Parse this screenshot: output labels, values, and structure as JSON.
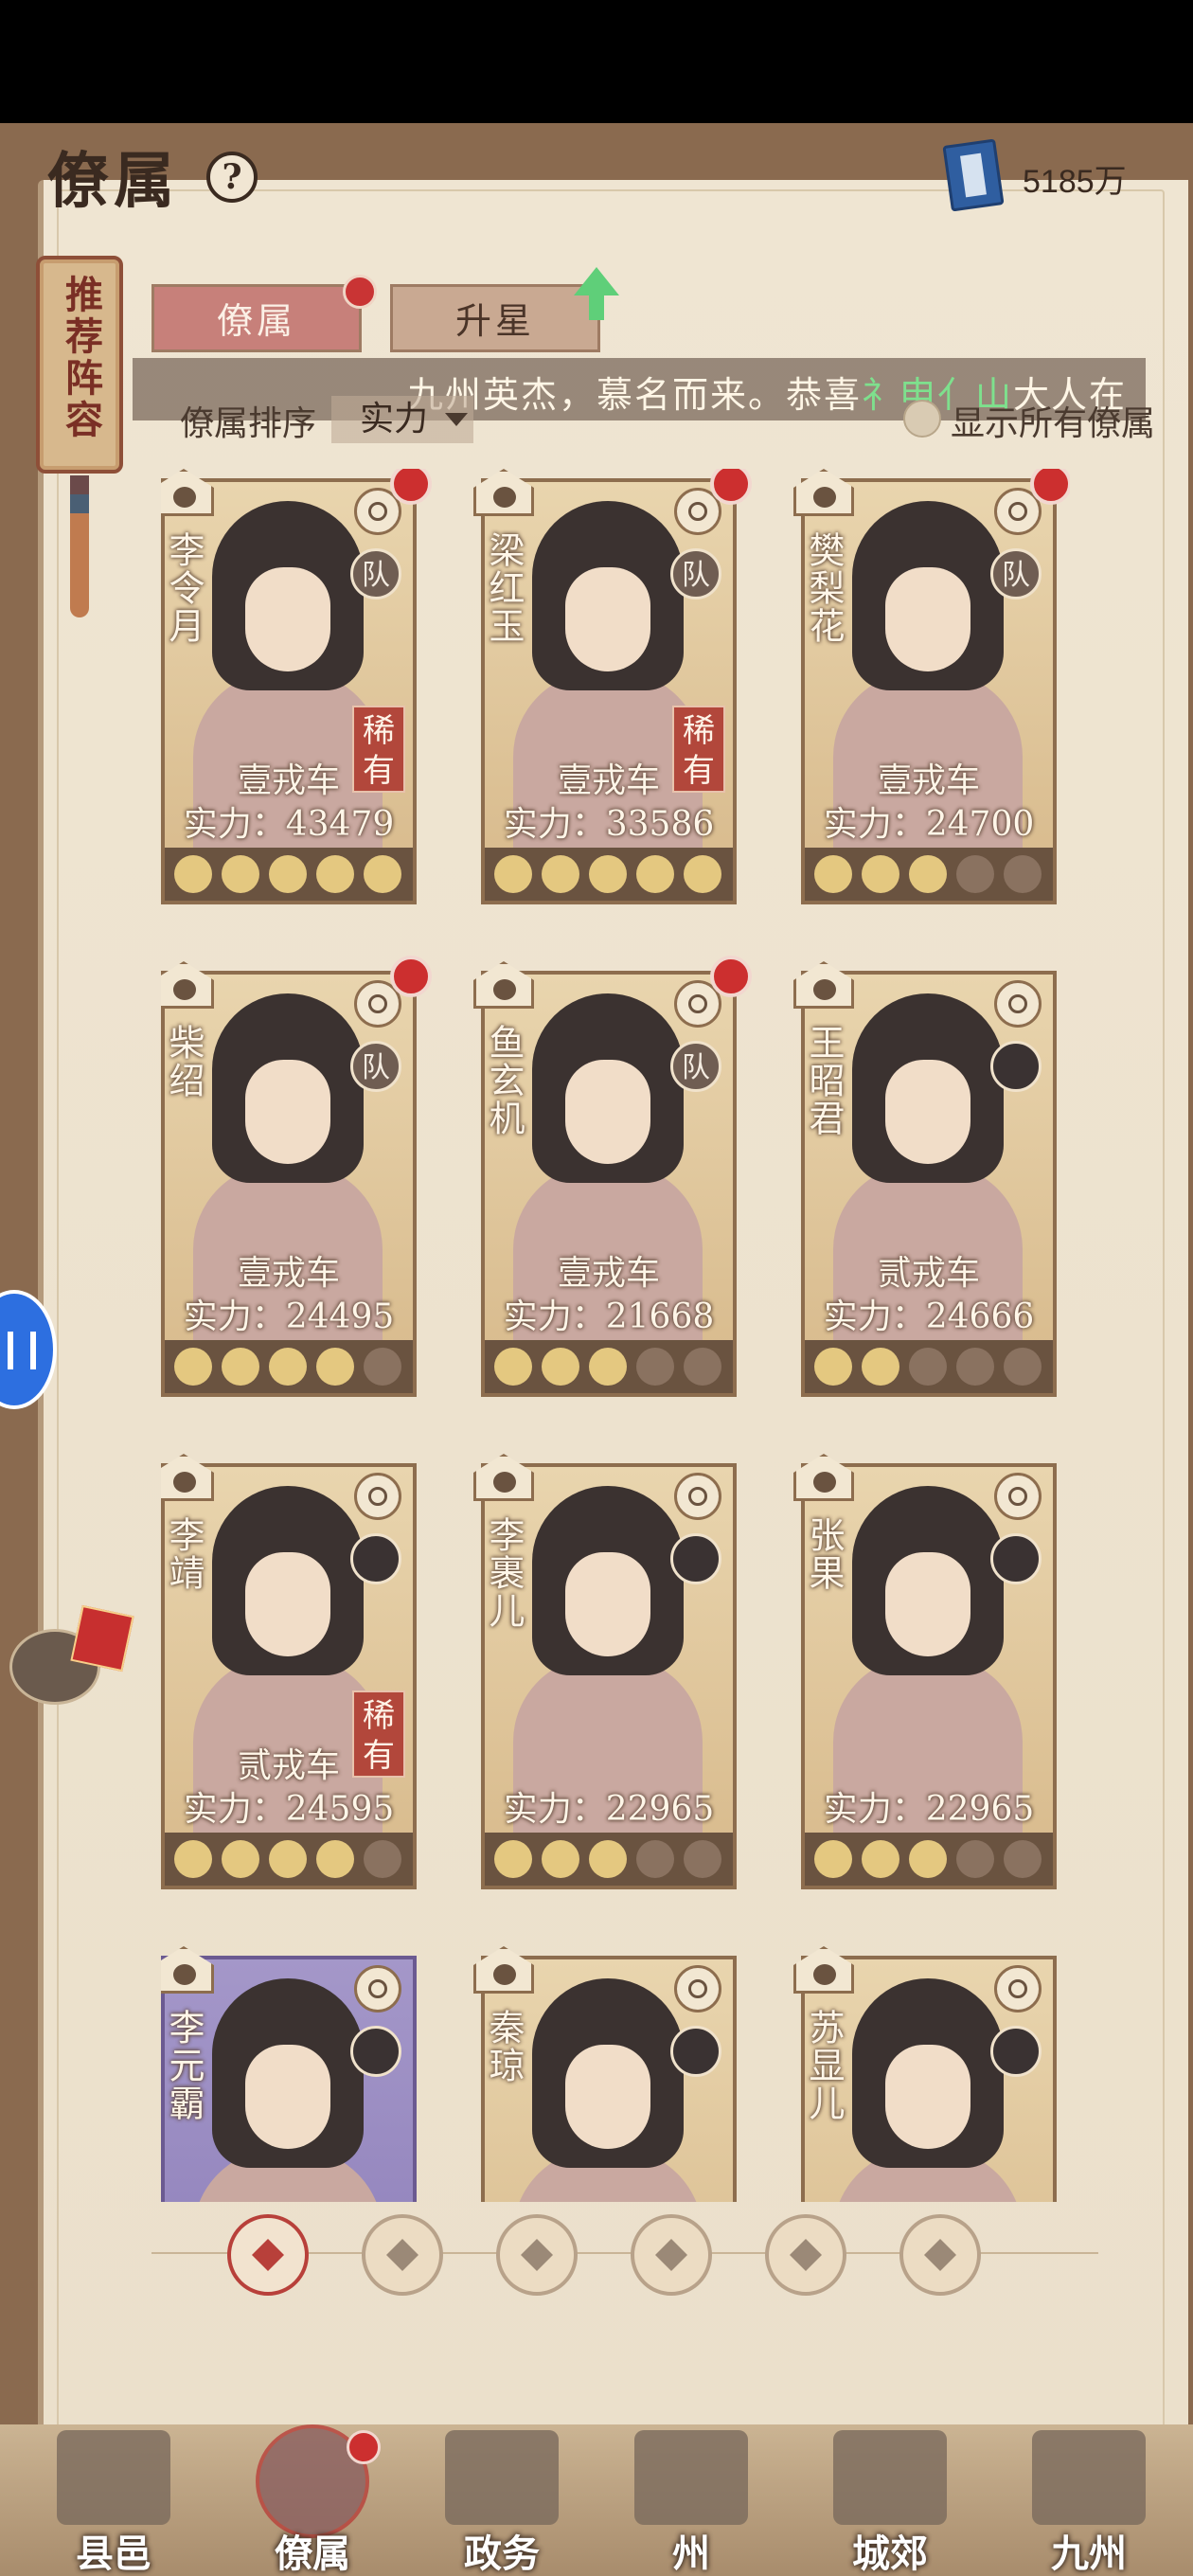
{
  "header": {
    "title": "僚属",
    "help_icon": "?",
    "currency_amount": "5185万"
  },
  "side_tag": {
    "text": "推荐阵容"
  },
  "tabs": [
    {
      "label": "僚属",
      "active": true,
      "has_badge": true
    },
    {
      "label": "升星",
      "active": false,
      "has_badge": false
    }
  ],
  "marquee": {
    "prefix": "九州英杰，慕名而来。恭喜",
    "highlight": "礻申亻山",
    "suffix": "大人在"
  },
  "sort": {
    "label": "僚属排序",
    "value": "实力",
    "show_all_label": "显示所有僚属"
  },
  "cards": [
    {
      "name": "李令月",
      "rank": "壹戎车",
      "power": "实力：43479",
      "rare": "稀有",
      "team": "队",
      "moons_filled": 5,
      "badge": true
    },
    {
      "name": "梁红玉",
      "rank": "壹戎车",
      "power": "实力：33586",
      "rare": "稀有",
      "team": "队",
      "moons_filled": 5,
      "badge": true
    },
    {
      "name": "樊梨花",
      "rank": "壹戎车",
      "power": "实力：24700",
      "rare": "",
      "team": "队",
      "moons_filled": 3,
      "badge": true
    },
    {
      "name": "柴绍",
      "rank": "壹戎车",
      "power": "实力：24495",
      "rare": "",
      "team": "队",
      "moons_filled": 4,
      "badge": true
    },
    {
      "name": "鱼玄机",
      "rank": "壹戎车",
      "power": "实力：21668",
      "rare": "",
      "team": "队",
      "moons_filled": 3,
      "badge": true
    },
    {
      "name": "王昭君",
      "rank": "贰戎车",
      "power": "实力：24666",
      "rare": "",
      "team": "",
      "moons_filled": 2,
      "badge": false
    },
    {
      "name": "李靖",
      "rank": "贰戎车",
      "power": "实力：24595",
      "rare": "稀有",
      "team": "",
      "moons_filled": 4,
      "badge": false
    },
    {
      "name": "李裹儿",
      "rank": "",
      "power": "实力：22965",
      "rare": "",
      "team": "",
      "moons_filled": 3,
      "badge": false
    },
    {
      "name": "张果",
      "rank": "",
      "power": "实力：22965",
      "rare": "",
      "team": "",
      "moons_filled": 3,
      "badge": false
    },
    {
      "name": "李元霸",
      "rank": "",
      "power": "",
      "rare": "",
      "team": "",
      "moons_filled": 0,
      "badge": false
    },
    {
      "name": "秦琼",
      "rank": "",
      "power": "",
      "rare": "",
      "team": "",
      "moons_filled": 0,
      "badge": false
    },
    {
      "name": "苏显儿",
      "rank": "",
      "power": "",
      "rare": "",
      "team": "",
      "moons_filled": 0,
      "badge": false
    }
  ],
  "filters": [
    {
      "icon": "all-filter-icon",
      "active": true
    },
    {
      "icon": "tortoise-clan-icon",
      "active": false
    },
    {
      "icon": "gourd-clan-icon",
      "active": false
    },
    {
      "icon": "fan-clan-icon",
      "active": false
    },
    {
      "icon": "lion-clan-icon",
      "active": false
    },
    {
      "icon": "flower-clan-icon",
      "active": false
    }
  ],
  "nav": [
    {
      "label": "县邑",
      "active": false
    },
    {
      "label": "僚属",
      "active": true
    },
    {
      "label": "政务",
      "active": false
    },
    {
      "label": "州",
      "active": false
    },
    {
      "label": "城郊",
      "active": false
    },
    {
      "label": "九州",
      "active": false
    }
  ],
  "colors": {
    "accent_red": "#cc2f2f",
    "paper": "#ebe0cb",
    "highlight_green": "#7ee08d"
  }
}
